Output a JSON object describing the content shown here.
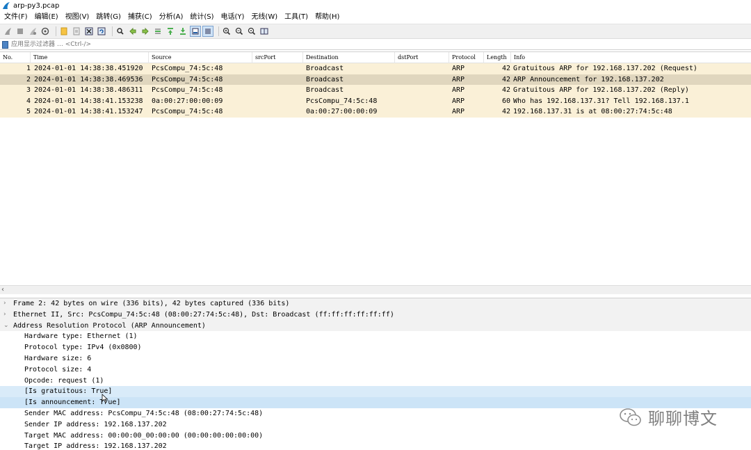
{
  "window": {
    "title": "arp-py3.pcap"
  },
  "menu": [
    "文件(F)",
    "编辑(E)",
    "视图(V)",
    "跳转(G)",
    "捕获(C)",
    "分析(A)",
    "统计(S)",
    "电话(Y)",
    "无线(W)",
    "工具(T)",
    "帮助(H)"
  ],
  "filter": {
    "placeholder": "应用显示过滤器 … <Ctrl-/>"
  },
  "packet_list": {
    "columns": [
      "No.",
      "Time",
      "Source",
      "srcPort",
      "Destination",
      "dstPort",
      "Protocol",
      "Length",
      "Info"
    ],
    "rows": [
      {
        "no": "1",
        "time": "2024-01-01 14:38:38.451920",
        "source": "PcsCompu_74:5c:48",
        "srcPort": "",
        "destination": "Broadcast",
        "dstPort": "",
        "protocol": "ARP",
        "length": "42",
        "info": "Gratuitous ARP for 192.168.137.202 (Request)"
      },
      {
        "no": "2",
        "time": "2024-01-01 14:38:38.469536",
        "source": "PcsCompu_74:5c:48",
        "srcPort": "",
        "destination": "Broadcast",
        "dstPort": "",
        "protocol": "ARP",
        "length": "42",
        "info": "ARP Announcement for 192.168.137.202"
      },
      {
        "no": "3",
        "time": "2024-01-01 14:38:38.486311",
        "source": "PcsCompu_74:5c:48",
        "srcPort": "",
        "destination": "Broadcast",
        "dstPort": "",
        "protocol": "ARP",
        "length": "42",
        "info": "Gratuitous ARP for 192.168.137.202 (Reply)"
      },
      {
        "no": "4",
        "time": "2024-01-01 14:38:41.153238",
        "source": "0a:00:27:00:00:09",
        "srcPort": "",
        "destination": "PcsCompu_74:5c:48",
        "dstPort": "",
        "protocol": "ARP",
        "length": "60",
        "info": "Who has 192.168.137.31? Tell 192.168.137.1"
      },
      {
        "no": "5",
        "time": "2024-01-01 14:38:41.153247",
        "source": "PcsCompu_74:5c:48",
        "srcPort": "",
        "destination": "0a:00:27:00:00:09",
        "dstPort": "",
        "protocol": "ARP",
        "length": "42",
        "info": "192.168.137.31 is at 08:00:27:74:5c:48"
      }
    ],
    "selected_row": 2
  },
  "details": {
    "frame": "Frame 2: 42 bytes on wire (336 bits), 42 bytes captured (336 bits)",
    "ethernet": "Ethernet II, Src: PcsCompu_74:5c:48 (08:00:27:74:5c:48), Dst: Broadcast (ff:ff:ff:ff:ff:ff)",
    "arp": "Address Resolution Protocol (ARP Announcement)",
    "arp_fields": [
      "Hardware type: Ethernet (1)",
      "Protocol type: IPv4 (0x0800)",
      "Hardware size: 6",
      "Protocol size: 4",
      "Opcode: request (1)",
      "[Is gratuitous: True]",
      "[Is announcement: True]",
      "Sender MAC address: PcsCompu_74:5c:48 (08:00:27:74:5c:48)",
      "Sender IP address: 192.168.137.202",
      "Target MAC address: 00:00:00_00:00:00 (00:00:00:00:00:00)",
      "Target IP address: 192.168.137.202"
    ]
  },
  "watermark": {
    "text": "聊聊博文"
  },
  "colors": {
    "arp_row": "#faf0d7",
    "selected_row": "#e0d6be",
    "highlight": "#d9ebf9"
  }
}
